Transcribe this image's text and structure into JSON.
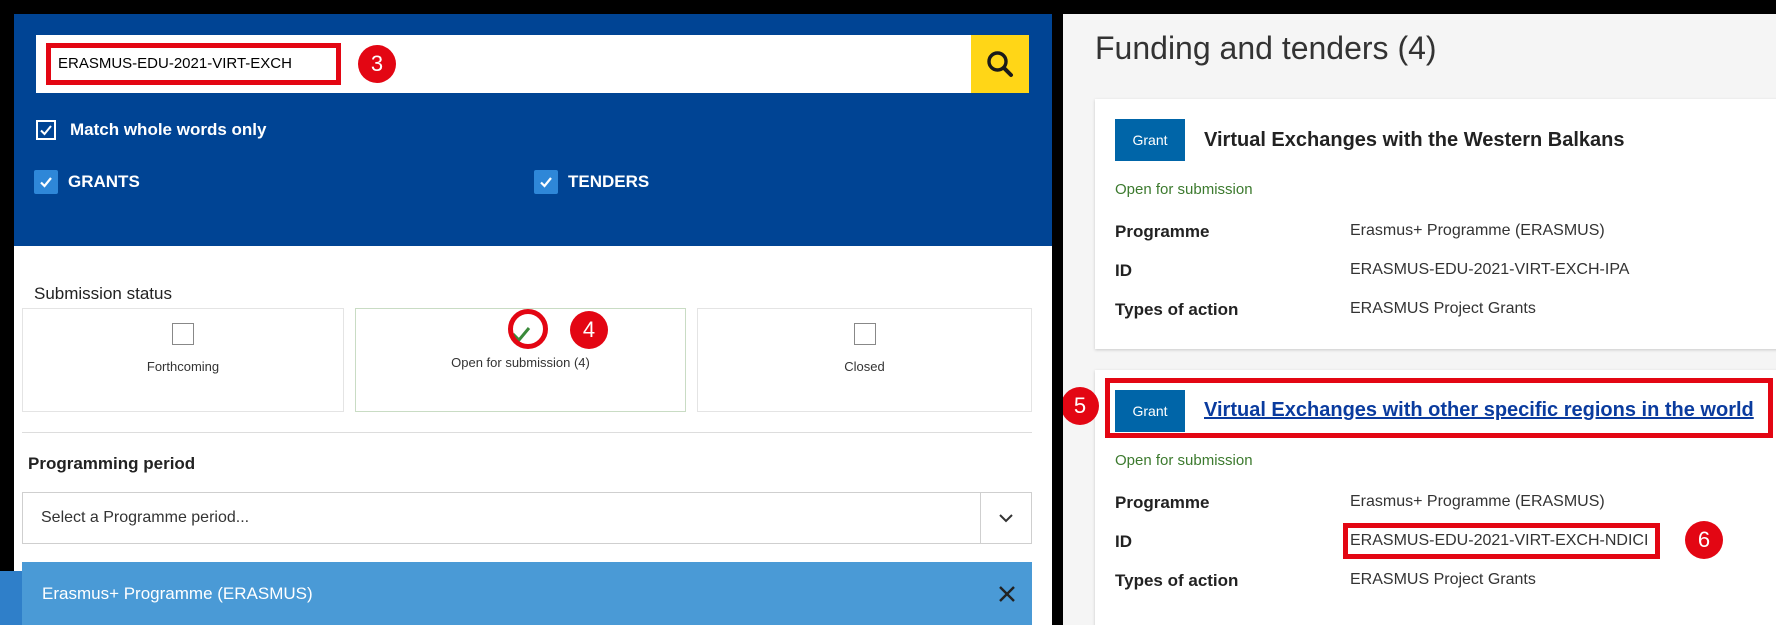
{
  "search": {
    "value": "ERASMUS-EDU-2021-VIRT-EXCH",
    "placeholder": ""
  },
  "filters": {
    "match_whole_words": "Match whole words only",
    "grants": "GRANTS",
    "tenders": "TENDERS"
  },
  "submission": {
    "title": "Submission status",
    "options": [
      {
        "label": "Forthcoming",
        "checked": false
      },
      {
        "label": "Open for submission (4)",
        "checked": true
      },
      {
        "label": "Closed",
        "checked": false
      }
    ]
  },
  "programming": {
    "title": "Programming period",
    "select_placeholder": "Select a Programme period...",
    "chip": "Erasmus+ Programme (ERASMUS)"
  },
  "results": {
    "title": "Funding and tenders (4)",
    "labels": {
      "programme": "Programme",
      "id": "ID",
      "types": "Types of action"
    },
    "items": [
      {
        "badge": "Grant",
        "title": "Virtual Exchanges with the Western Balkans",
        "status": "Open for submission",
        "programme": "Erasmus+ Programme (ERASMUS)",
        "id": "ERASMUS-EDU-2021-VIRT-EXCH-IPA",
        "types": "ERASMUS Project Grants"
      },
      {
        "badge": "Grant",
        "title": "Virtual Exchanges with other specific regions in the world",
        "status": "Open for submission",
        "programme": "Erasmus+ Programme (ERASMUS)",
        "id": "ERASMUS-EDU-2021-VIRT-EXCH-NDICI",
        "types": "ERASMUS Project Grants"
      }
    ]
  },
  "annotations": [
    "3",
    "4",
    "5",
    "6"
  ],
  "colors": {
    "header_blue": "#004494",
    "search_yellow": "#ffd617",
    "annotation_red": "#e30613",
    "grant_blue": "#0065a8",
    "status_green": "#3c7a2e",
    "chip_blue": "#4a9ad6"
  },
  "icons": {
    "search": "search-icon",
    "check": "check-icon",
    "chevron": "chevron-down-icon",
    "close": "close-icon"
  }
}
